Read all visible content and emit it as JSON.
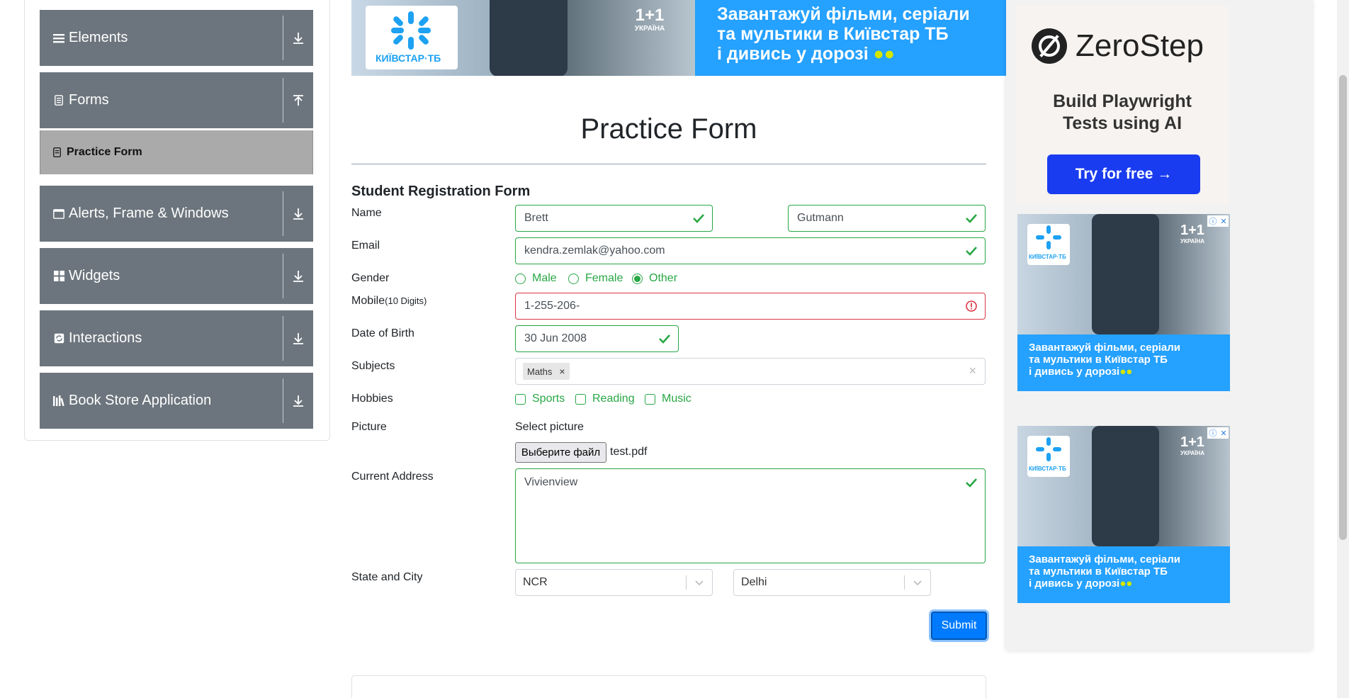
{
  "sidebar": {
    "groups": [
      {
        "label": "Elements",
        "icon": "list-icon",
        "arrow": "download-arrow-icon"
      },
      {
        "label": "Forms",
        "icon": "form-icon",
        "arrow": "upload-arrow-icon"
      },
      {
        "label": "Alerts, Frame & Windows",
        "icon": "window-icon",
        "arrow": "download-arrow-icon"
      },
      {
        "label": "Widgets",
        "icon": "grid-icon",
        "arrow": "download-arrow-icon"
      },
      {
        "label": "Interactions",
        "icon": "interactions-icon",
        "arrow": "download-arrow-icon"
      },
      {
        "label": "Book Store Application",
        "icon": "books-icon",
        "arrow": "download-arrow-icon"
      }
    ],
    "active_item": "Practice Form"
  },
  "ad_top": {
    "brand": "КИЇВСТАР·ТБ",
    "channel": "1+1",
    "channel_sub": "УКРАЇНА",
    "line1": "Завантажуй фільми, серіали",
    "line2": "та мультики в Київстар ТБ",
    "line3": "і дивись у дорозі"
  },
  "form": {
    "title": "Practice Form",
    "subtitle": "Student Registration Form",
    "labels": {
      "name": "Name",
      "email": "Email",
      "gender": "Gender",
      "mobile": "Mobile",
      "mobile_hint": "(10 Digits)",
      "dob": "Date of Birth",
      "subjects": "Subjects",
      "hobbies": "Hobbies",
      "picture": "Picture",
      "address": "Current Address",
      "state_city": "State and City"
    },
    "first_name": "Brett",
    "last_name": "Gutmann",
    "email": "kendra.zemlak@yahoo.com",
    "gender_options": [
      "Male",
      "Female",
      "Other"
    ],
    "gender_selected": "Other",
    "mobile": "1-255-206-",
    "dob": "30 Jun 2008",
    "subjects": [
      "Maths"
    ],
    "hobbies": [
      "Sports",
      "Reading",
      "Music"
    ],
    "picture_label": "Select picture",
    "file_button": "Выберите файл",
    "file_name": "test.pdf",
    "address": "Vivienview",
    "state": "NCR",
    "city": "Delhi",
    "submit": "Submit"
  },
  "ad_right": {
    "zerostep_name": "ZeroStep",
    "zerostep_tag1": "Build Playwright",
    "zerostep_tag2": "Tests using AI",
    "zerostep_cta": "Try for free →",
    "kyivstar_line1": "Завантажуй фільми, серіали",
    "kyivstar_line2": "та мультики в Київстар ТБ",
    "kyivstar_line3": "і дивись у дорозі",
    "kyivstar_brand": "КИЇВСТАР·ТБ",
    "channel": "1+1",
    "channel_sub": "УКРАЇНА"
  },
  "colors": {
    "valid": "#28a745",
    "invalid": "#dc3545",
    "primary": "#007bff",
    "sidebar_group": "#6c757d",
    "sidebar_active": "#aaaaaa",
    "ad_blue": "#25a1ff"
  }
}
